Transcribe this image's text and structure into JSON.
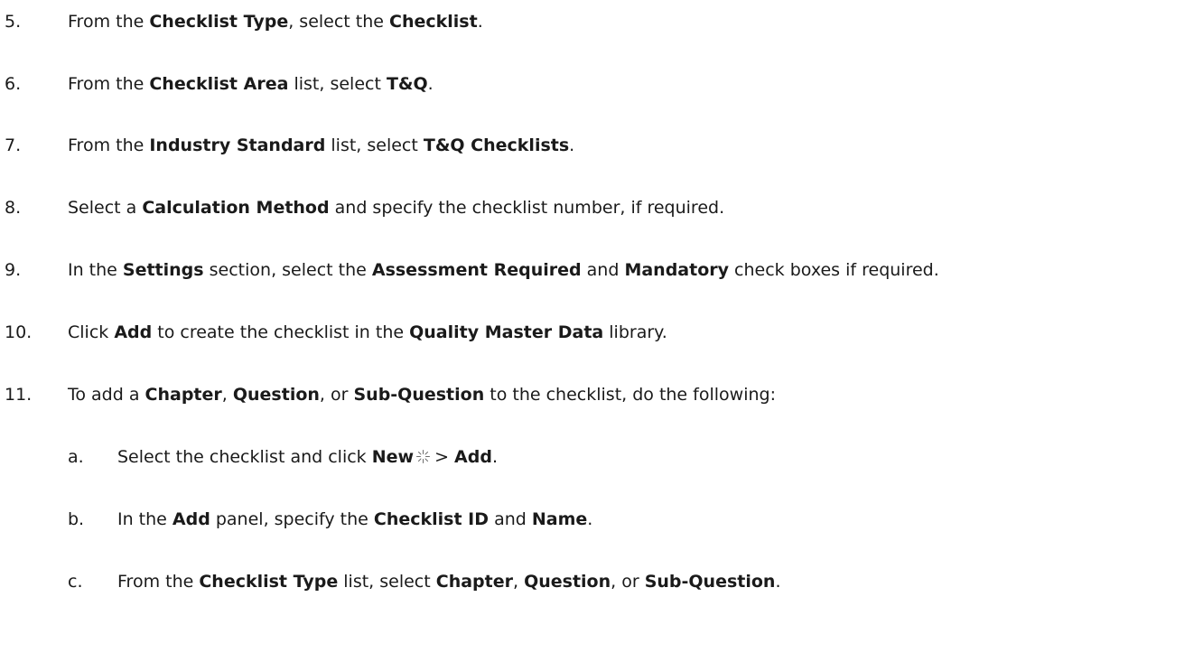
{
  "steps": [
    {
      "num": "5.",
      "parts": [
        {
          "t": "From the "
        },
        {
          "t": "Checklist Type",
          "b": true
        },
        {
          "t": ", select the "
        },
        {
          "t": "Checklist",
          "b": true
        },
        {
          "t": "."
        }
      ]
    },
    {
      "num": "6.",
      "parts": [
        {
          "t": "From the "
        },
        {
          "t": "Checklist Area",
          "b": true
        },
        {
          "t": " list, select "
        },
        {
          "t": "T&Q",
          "b": true
        },
        {
          "t": "."
        }
      ]
    },
    {
      "num": "7.",
      "parts": [
        {
          "t": "From the "
        },
        {
          "t": "Industry Standard",
          "b": true
        },
        {
          "t": " list, select "
        },
        {
          "t": "T&Q Checklists",
          "b": true
        },
        {
          "t": "."
        }
      ]
    },
    {
      "num": "8.",
      "parts": [
        {
          "t": "Select a "
        },
        {
          "t": "Calculation Method",
          "b": true
        },
        {
          "t": " and specify the checklist number, if required."
        }
      ]
    },
    {
      "num": "9.",
      "parts": [
        {
          "t": "In the "
        },
        {
          "t": "Settings",
          "b": true
        },
        {
          "t": " section, select the "
        },
        {
          "t": "Assessment Required",
          "b": true
        },
        {
          "t": " and "
        },
        {
          "t": "Mandatory",
          "b": true
        },
        {
          "t": " check boxes if required."
        }
      ]
    },
    {
      "num": "10.",
      "parts": [
        {
          "t": "Click "
        },
        {
          "t": "Add",
          "b": true
        },
        {
          "t": " to create the checklist in the "
        },
        {
          "t": "Quality Master Data",
          "b": true
        },
        {
          "t": " library."
        }
      ]
    },
    {
      "num": "11.",
      "parts": [
        {
          "t": "To add a "
        },
        {
          "t": "Chapter",
          "b": true
        },
        {
          "t": ", "
        },
        {
          "t": "Question",
          "b": true
        },
        {
          "t": ", or "
        },
        {
          "t": "Sub-Question",
          "b": true
        },
        {
          "t": " to the checklist, do the following:"
        }
      ]
    }
  ],
  "substeps": [
    {
      "num": "a.",
      "parts": [
        {
          "t": "Select the checklist and click "
        },
        {
          "t": "New",
          "b": true
        },
        {
          "icon": "new-sparkle-icon"
        },
        {
          "t": "> "
        },
        {
          "t": "Add",
          "b": true
        },
        {
          "t": "."
        }
      ]
    },
    {
      "num": "b.",
      "parts": [
        {
          "t": "In the "
        },
        {
          "t": "Add",
          "b": true
        },
        {
          "t": " panel, specify the "
        },
        {
          "t": "Checklist ID",
          "b": true
        },
        {
          "t": " and "
        },
        {
          "t": "Name",
          "b": true
        },
        {
          "t": "."
        }
      ]
    },
    {
      "num": "c.",
      "parts": [
        {
          "t": "From the "
        },
        {
          "t": "Checklist Type",
          "b": true
        },
        {
          "t": " list, select "
        },
        {
          "t": "Chapter",
          "b": true
        },
        {
          "t": ", "
        },
        {
          "t": "Question",
          "b": true
        },
        {
          "t": ", or "
        },
        {
          "t": "Sub-Question",
          "b": true
        },
        {
          "t": "."
        }
      ]
    }
  ],
  "colors": {
    "text": "#1a1a1a",
    "background": "#ffffff"
  }
}
